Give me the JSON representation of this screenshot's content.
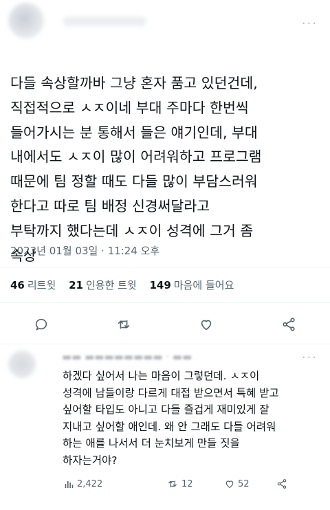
{
  "tweet": {
    "lines": [
      "다들 속상할까바 그냥 혼자 품고 있던건데,",
      "직접적으로 ㅅㅈ이네 부대 주마다 한번씩",
      "들어가시는 분 통해서 들은 얘기인데, 부대",
      "내에서도 ㅅㅈ이 많이 어려워하고 프로그램",
      "때문에 팀 정할 때도 다들 많이 부담스러워",
      "한다고 따로 팀 배정 신경써달라고",
      "부탁까지 했다는데 ㅅㅈ이 성격에 그거 좀",
      "속상"
    ],
    "timestamp": "2023년 01월 03일 · 11:24 오후"
  },
  "stats": {
    "retweets_count": "46",
    "retweets_label": "리트윗",
    "quotes_count": "21",
    "quotes_label": "인용한 트윗",
    "likes_count": "149",
    "likes_label": "마음에 들어요"
  },
  "actions": {
    "icons": [
      "reply-icon",
      "retweet-icon",
      "like-icon",
      "share-icon"
    ]
  },
  "reply": {
    "lines": [
      "하겠다 싶어서 나는 마음이 그렇던데. ㅅㅈ이",
      "성격에 남들이랑 다르게 대접 받으면서 특혜 받고",
      "싶어할 타입도 아니고 다들 즐겁게 재미있게 잘",
      "지내고 싶어할 애인데. 왜 안 그래도 다들 어려워",
      "하는 애를 나서서 더 눈치보게 만들 짓을",
      "하자는거야?"
    ],
    "views": "2,422",
    "retweets": "12",
    "likes": "52"
  },
  "colors": {
    "text": "#0f1419",
    "muted": "#536471",
    "separator": "#eff3f4"
  }
}
